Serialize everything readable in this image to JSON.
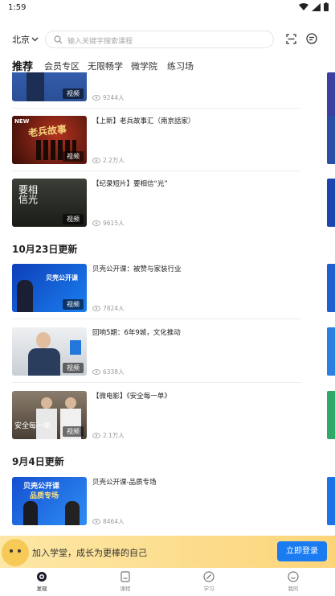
{
  "status": {
    "time": "1:59"
  },
  "header": {
    "city": "北京",
    "search_placeholder": "输入关键字搜索课程"
  },
  "tabs": [
    "推荐",
    "会员专区",
    "无限畅学",
    "微学院",
    "练习场"
  ],
  "feed": {
    "top_item": {
      "tag": "视频",
      "views": "9244人"
    },
    "items_a": [
      {
        "title": "【上新】老兵故事汇（南京話家）",
        "tag": "视频",
        "views": "2.2万人"
      },
      {
        "title": "【纪录短片】要相信“光”",
        "tag": "视频",
        "views": "9615人"
      }
    ],
    "section_1": "10月23日更新",
    "items_b": [
      {
        "title": "贝壳公开课：被赞与家装行业",
        "tag": "视频",
        "views": "7824人"
      },
      {
        "title": "回响5期：6年9城，文化推动",
        "tag": "视频",
        "views": "6338人"
      },
      {
        "title": "【微电影】《安全每一单》",
        "tag": "视频",
        "views": "2.1万人"
      }
    ],
    "section_2": "9月4日更新",
    "items_c": [
      {
        "title": "贝壳公开课-品质专场",
        "tag": "视频",
        "views": "8464人"
      }
    ],
    "thumb_texts": {
      "new_badge": "NEW",
      "laobing": "老兵故事",
      "xin_guang": "要相信光",
      "beike_open": "贝壳公开课",
      "anquan": "安全每一单",
      "pinzhi_1": "贝壳公开课",
      "pinzhi_2": "品质专场"
    }
  },
  "banner": {
    "text": "加入学堂，成长为更棒的自己",
    "button": "立即登录"
  },
  "bottom_nav": [
    "发现",
    "课程",
    "学习",
    "我的"
  ],
  "colors": {
    "accent": "#1a7cf0",
    "banner": "#fcd57a"
  }
}
